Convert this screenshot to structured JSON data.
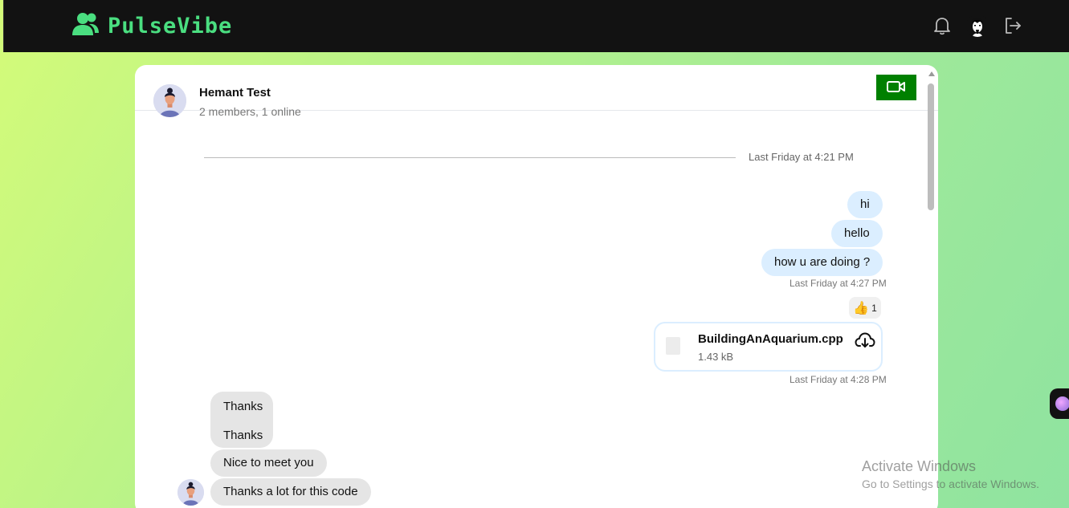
{
  "app": {
    "brand": "PulseVibe",
    "brand_color": "#4ade80"
  },
  "topbar": {
    "icons": [
      "bell-icon",
      "user-avatar",
      "logout-icon"
    ]
  },
  "chat": {
    "name": "Hemant Test",
    "status": "2 members, 1 online",
    "divider": "Last Friday at 4:21 PM",
    "outgoing": [
      "hi",
      "hello",
      "how u are doing ?"
    ],
    "outgoing_timestamp": "Last Friday at 4:27 PM",
    "reaction": {
      "emoji": "👍",
      "count": "1"
    },
    "file": {
      "name": "BuildingAnAquarium.cpp",
      "size": "1.43 kB"
    },
    "file_timestamp": "Last Friday at 4:28 PM",
    "incoming": [
      "Thanks",
      "Thanks",
      "Nice to meet you",
      "Thanks a lot for this code"
    ]
  },
  "watermark": {
    "title": "Activate Windows",
    "subtitle": "Go to Settings to activate Windows."
  }
}
